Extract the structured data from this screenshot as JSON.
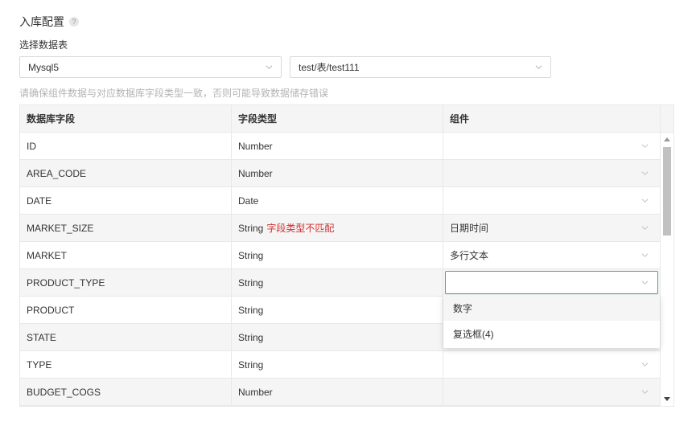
{
  "header": {
    "title": "入库配置",
    "help_glyph": "?"
  },
  "select_table_label": "选择数据表",
  "selects": {
    "database": "Mysql5",
    "table": "test/表/test111"
  },
  "hint": "请确保组件数据与对应数据库字段类型一致，否则可能导致数据储存错误",
  "table": {
    "columns": [
      "数据库字段",
      "字段类型",
      "组件"
    ],
    "rows": [
      {
        "field": "ID",
        "type": "Number",
        "warning": "",
        "component": ""
      },
      {
        "field": "AREA_CODE",
        "type": "Number",
        "warning": "",
        "component": ""
      },
      {
        "field": "DATE",
        "type": "Date",
        "warning": "",
        "component": ""
      },
      {
        "field": "MARKET_SIZE",
        "type": "String",
        "warning": "字段类型不匹配",
        "component": "日期时间"
      },
      {
        "field": "MARKET",
        "type": "String",
        "warning": "",
        "component": "多行文本"
      },
      {
        "field": "PRODUCT_TYPE",
        "type": "String",
        "warning": "",
        "component": ""
      },
      {
        "field": "PRODUCT",
        "type": "String",
        "warning": "",
        "component": ""
      },
      {
        "field": "STATE",
        "type": "String",
        "warning": "",
        "component": ""
      },
      {
        "field": "TYPE",
        "type": "String",
        "warning": "",
        "component": ""
      },
      {
        "field": "BUDGET_COGS",
        "type": "Number",
        "warning": "",
        "component": ""
      }
    ]
  },
  "dropdown": {
    "options": [
      "数字",
      "复选框(4)"
    ]
  },
  "colors": {
    "warning": "#d12f2f",
    "focus_border": "#3db36b"
  }
}
